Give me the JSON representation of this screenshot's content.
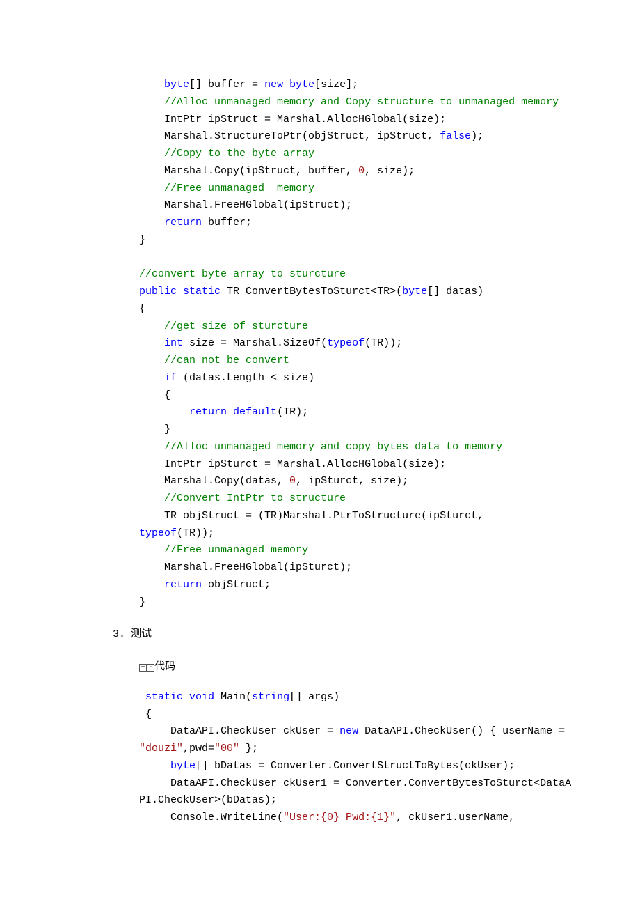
{
  "block1": {
    "l1": {
      "a": "byte",
      "b": "[] buffer = ",
      "c": "new",
      "d": " ",
      "e": "byte",
      "f": "[size];"
    },
    "l2": "//Alloc unmanaged memory and Copy structure to unmanaged memory",
    "l3": "IntPtr ipStruct = Marshal.AllocHGlobal(size);",
    "l4": {
      "a": "Marshal.StructureToPtr(objStruct, ipStruct, ",
      "b": "false",
      "c": ");"
    },
    "l5": "//Copy to the byte array",
    "l6": {
      "a": "Marshal.Copy(ipStruct, buffer, ",
      "b": "0",
      "c": ", size);"
    },
    "l7": "//Free unmanaged  memory",
    "l8": "Marshal.FreeHGlobal(ipStruct);",
    "l9": {
      "a": "return",
      "b": " buffer;"
    },
    "l10": "}",
    "l11": "//convert byte array to sturcture",
    "l12": {
      "a": "public",
      "b": " ",
      "c": "static",
      "d": " TR ConvertBytesToSturct<TR>(",
      "e": "byte",
      "f": "[] datas)"
    },
    "l13": "{",
    "l14": "//get size of sturcture",
    "l15": {
      "a": "int",
      "b": " size = Marshal.SizeOf(",
      "c": "typeof",
      "d": "(TR));"
    },
    "l16": "//can not be convert",
    "l17": {
      "a": "if",
      "b": " (datas.Length < size)"
    },
    "l18": "{",
    "l19": {
      "a": "return",
      "b": " ",
      "c": "default",
      "d": "(TR);"
    },
    "l20": "}",
    "l21": "//Alloc unmanaged memory and copy bytes data to memory",
    "l22": "IntPtr ipSturct = Marshal.AllocHGlobal(size);",
    "l23": {
      "a": "Marshal.Copy(datas, ",
      "b": "0",
      "c": ", ipSturct, size);"
    },
    "l24": "//Convert IntPtr to structure",
    "l25a": "TR objStruct = (TR)Marshal.PtrToStructure(ipSturct, ",
    "l25b": {
      "a": "typeof",
      "b": "(TR));"
    },
    "l26": "//Free unmanaged memory",
    "l27": "Marshal.FreeHGlobal(ipSturct);",
    "l28": {
      "a": "return",
      "b": " objStruct;"
    },
    "l29": "}"
  },
  "section3": {
    "num": "3.",
    "title": "测试"
  },
  "collapse": {
    "plus": "+",
    "minus": "-",
    "label": "代码"
  },
  "block2": {
    "l1": {
      "a": " ",
      "b": "static",
      "c": " ",
      "d": "void",
      "e": " Main(",
      "f": "string",
      "g": "[] args)"
    },
    "l2": " {",
    "l3": {
      "a": "     DataAPI.CheckUser ckUser = ",
      "b": "new",
      "c": " DataAPI.CheckUser() { userName = ",
      "d": "\"douzi\"",
      "e": ",pwd=",
      "f": "\"00\"",
      "g": " };"
    },
    "l4": {
      "a": "     ",
      "b": "byte",
      "c": "[] bDatas = Converter.ConvertStructToBytes(ckUser);"
    },
    "l5": "     DataAPI.CheckUser ckUser1 = Converter.ConvertBytesToSturct<DataAPI.CheckUser>(bDatas);",
    "l6": {
      "a": "     Console.WriteLine(",
      "b": "\"User:{0} Pwd:{1}\"",
      "c": ", ckUser1.userName, "
    }
  }
}
